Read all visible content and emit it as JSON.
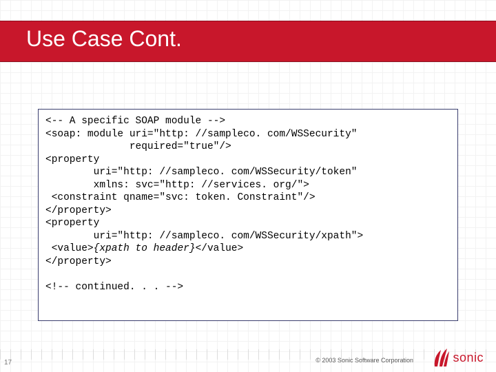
{
  "slide": {
    "title": "Use Case Cont.",
    "number": "17"
  },
  "code": {
    "l1": "<-- A specific SOAP module -->",
    "l2": "<soap: module uri=\"http: //sampleco. com/WSSecurity\"",
    "l3": "              required=\"true\"/>",
    "l4": "<property",
    "l5": "        uri=\"http: //sampleco. com/WSSecurity/token\"",
    "l6": "        xmlns: svc=\"http: //services. org/\">",
    "l7": " <constraint qname=\"svc: token. Constraint\"/>",
    "l8": "</property>",
    "l9": "<property",
    "l10": "        uri=\"http: //sampleco. com/WSSecurity/xpath\">",
    "l11a": " <value>",
    "l11b": "{xpath to header}",
    "l11c": "</value>",
    "l12": "</property>",
    "l13": "",
    "l14": "<!-- continued. . . -->"
  },
  "footer": {
    "copyright": "© 2003 Sonic Software Corporation",
    "logo_text": "sonic"
  }
}
